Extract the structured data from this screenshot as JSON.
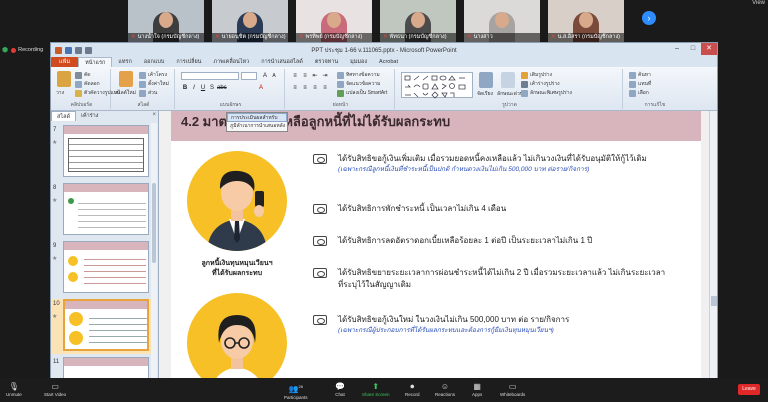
{
  "gallery": {
    "participants": [
      {
        "name": "นางน้ำใจ (กรมบัญชีกลาง)"
      },
      {
        "name": "นายอนุชิต (กรมบัญชีกลาง)"
      },
      {
        "name": "พรทิพย์ (กรมบัญชีกลาง)"
      },
      {
        "name": "พัทธนา (กรมบัญชีกลาง)"
      },
      {
        "name": "นางสาว"
      },
      {
        "name": "น.ส.อิสรา (กรมบัญชีกลาง)"
      }
    ],
    "view_label": "View"
  },
  "recording": {
    "label": "Recording"
  },
  "window": {
    "title": "PPT ประชุม 1-66 v.111065.pptx - Microsoft PowerPoint",
    "minimize": "–",
    "maximize": "□",
    "close": "✕"
  },
  "ribbon_tabs": [
    "แฟ้ม",
    "หน้าแรก",
    "แทรก",
    "ออกแบบ",
    "การเปลี่ยน",
    "ภาพเคลื่อนไหว",
    "การนำเสนอสไลด์",
    "ตรวจทาน",
    "มุมมอง",
    "Acrobat"
  ],
  "ribbon": {
    "paste": "วาง",
    "cut": "ตัด",
    "copy": "คัดลอก",
    "format_painter": "ตัวคัดวางรูปแบบ",
    "clipboard_group": "คลิปบอร์ด",
    "new_slide": "สไลด์ใหม่",
    "layout": "เค้าโครง",
    "reset": "ตั้งค่าใหม่",
    "section": "ส่วน",
    "slides_group": "สไลด์",
    "font_group": "แบบอักษร",
    "paragraph_group": "ย่อหน้า",
    "text_direction": "ทิศทางข้อความ",
    "align_text": "จัดแนวข้อความ",
    "smartart": "แปลงเป็น SmartArt",
    "drawing_group": "รูปวาด",
    "arrange": "จัดเรียง",
    "quick_styles": "ลักษณะด่วน",
    "shape_fill": "เติมรูปร่าง",
    "shape_outline": "เค้าร่างรูปร่าง",
    "shape_effects": "ลักษณะพิเศษรูปร่าง",
    "find": "ค้นหา",
    "replace": "แทนที่",
    "select": "เลือก",
    "editing_group": "การแก้ไข"
  },
  "pane": {
    "tab_slides": "สไลด์",
    "tab_outline": "เค้าร่าง",
    "close": "×",
    "slide_numbers": [
      "7",
      "8",
      "9",
      "10",
      "11"
    ]
  },
  "slide": {
    "title": "4.2 มาตรการช่วยเหลือลูกหนี้ที่ไม่ได้รับผลกระทบ",
    "dropdown": {
      "item1": "การประเมินผลสำหรับ",
      "item2": "ภูมิลำเนาการนำเสนอหลัง"
    },
    "caption_line1": "ลูกหนี้เงินทุนหมุนเวียนฯ",
    "caption_line2": "ที่ได้รับผลกระทบ",
    "bullets": [
      {
        "text": "ได้รับสิทธิขอกู้เงินเพิ่มเติม เมื่อรวมยอดหนี้คงเหลือแล้ว ไม่เกินวงเงินที่ได้รับอนุมัติให้กู้ไว้เดิม",
        "sub": "(เฉพาะกรณีลูกหนี้เงินที่ชำระหนี้เป็นปกติ กำหนดวงเงินไม่เกิน 500,000 บาท ต่อราย/กิจการ)"
      },
      {
        "text": "ได้รับสิทธิการพักชำระหนี้ เป็นเวลาไม่เกิน 4 เดือน",
        "sub": ""
      },
      {
        "text": "ได้รับสิทธิการลดอัตราดอกเบี้ยเหลือร้อยละ 1 ต่อปี เป็นระยะเวลาไม่เกิน 1 ปี",
        "sub": ""
      },
      {
        "text": "ได้รับสิทธิขยายระยะเวลาการผ่อนชำระหนี้ได้ไม่เกิน 2 ปี เมื่อรวมระยะเวลาแล้ว ไม่เกินระยะเวลา",
        "text2": "ที่ระบุไว้ในสัญญาเดิม",
        "sub": ""
      },
      {
        "text": "ได้รับสิทธิขอกู้เงินใหม่ ในวงเงินไม่เกิน 500,000 บาท ต่อ ราย/กิจการ",
        "sub": "(เฉพาะกรณีผู้ประกอบการที่ได้รับผลกระทบและต้องการกู้ยืมเงินทุนหมุนเวียนฯ)"
      }
    ]
  },
  "zoom_toolbar": {
    "unmute": "Unmute",
    "start_video": "Start Video",
    "participants": "Participants",
    "participants_count": "26",
    "chat": "Chat",
    "share_screen": "Share Screen",
    "record": "Record",
    "reactions": "Reactions",
    "apps": "Apps",
    "whiteboards": "Whiteboards",
    "leave": "Leave"
  },
  "colors": {
    "slide_header": "#d8b4bc",
    "avatar_yellow": "#f6c026",
    "sub_text_blue": "#2a4fb8",
    "share_green": "#3bc65c",
    "leave_red": "#e02828"
  }
}
